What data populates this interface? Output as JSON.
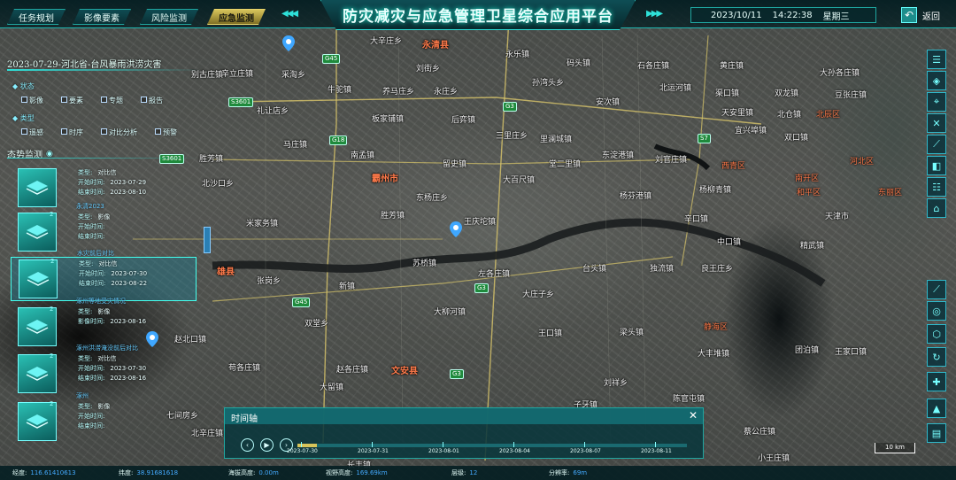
{
  "header": {
    "tabs": [
      {
        "label": "任务规划",
        "active": false
      },
      {
        "label": "影像要素",
        "active": false
      },
      {
        "label": "风险监测",
        "active": false
      },
      {
        "label": "应急监测",
        "active": true
      }
    ],
    "title": "防灾减灾与应急管理卫星综合应用平台",
    "date": "2023/10/11",
    "time": "14:22:38",
    "weekday": "星期三",
    "back_label": "返回",
    "accent_color": "#2ee0d8",
    "active_tab_color": "#d7c45a"
  },
  "left_panel": {
    "event_title": "2023-07-29-河北省-台风暴雨洪涝灾害",
    "filters": {
      "status_group": "状态",
      "status_options": [
        "影像",
        "要素",
        "专题",
        "报告"
      ],
      "type_group": "类型",
      "type_options": [
        "遥感",
        "时序",
        "对比分析",
        "预警"
      ]
    },
    "section_title": "态势监测",
    "cards": [
      {
        "name": "",
        "badge": "",
        "rows": [
          {
            "k": "类型:",
            "v": "对比信"
          },
          {
            "k": "开始时间:",
            "v": "2023-07-29"
          },
          {
            "k": "结束时间:",
            "v": "2023-08-10"
          }
        ],
        "selected": false
      },
      {
        "name": "永清2023",
        "badge": "2",
        "rows": [
          {
            "k": "类型:",
            "v": "影像"
          },
          {
            "k": "开始时间:",
            "v": ""
          },
          {
            "k": "结束时间:",
            "v": ""
          }
        ],
        "selected": false
      },
      {
        "name": "水灾前后对比",
        "badge": "2",
        "rows": [
          {
            "k": "类型:",
            "v": "对比信"
          },
          {
            "k": "开始时间:",
            "v": "2023-07-30"
          },
          {
            "k": "结束时间:",
            "v": "2023-08-22"
          }
        ],
        "selected": true
      },
      {
        "name": "涿州等地受灾情况",
        "badge": "2",
        "rows": [
          {
            "k": "类型:",
            "v": "影像"
          },
          {
            "k": "影像时间:",
            "v": "2023-08-16"
          }
        ],
        "selected": false
      },
      {
        "name": "涿州洪涝淹没前后对比",
        "badge": "2",
        "rows": [
          {
            "k": "类型:",
            "v": "对比信"
          },
          {
            "k": "开始时间:",
            "v": "2023-07-30"
          },
          {
            "k": "结束时间:",
            "v": "2023-08-16"
          }
        ],
        "selected": false
      },
      {
        "name": "涿州",
        "badge": "2",
        "rows": [
          {
            "k": "类型:",
            "v": "影像"
          },
          {
            "k": "开始时间:",
            "v": ""
          },
          {
            "k": "结束时间:",
            "v": ""
          }
        ],
        "selected": false
      }
    ]
  },
  "map": {
    "places": [
      {
        "t": "大辛庄乡"
      },
      {
        "t": "永清县",
        "c": "city"
      },
      {
        "t": "刘街乡"
      },
      {
        "t": "码头镇"
      },
      {
        "t": "石各庄镇"
      },
      {
        "t": "黄庄镇"
      },
      {
        "t": "大孙各庄镇"
      },
      {
        "t": "采淘乡"
      },
      {
        "t": "别古庄镇"
      },
      {
        "t": "永乐镇"
      },
      {
        "t": "辛立庄镇"
      },
      {
        "t": "牛驼镇"
      },
      {
        "t": "养马庄乡"
      },
      {
        "t": "永庄乡"
      },
      {
        "t": "孙湾头乡"
      },
      {
        "t": "渠口镇"
      },
      {
        "t": "双龙镇"
      },
      {
        "t": "北运河镇"
      },
      {
        "t": "豆张庄镇"
      },
      {
        "t": "后弈镇"
      },
      {
        "t": "礼让店乡"
      },
      {
        "t": "板家铺镇"
      },
      {
        "t": "安次镇"
      },
      {
        "t": "天安里镇"
      },
      {
        "t": "北辰区",
        "c": "district"
      },
      {
        "t": "马庄镇"
      },
      {
        "t": "三里庄乡"
      },
      {
        "t": "里澜城镇"
      },
      {
        "t": "宜兴埠镇"
      },
      {
        "t": "北仓镇"
      },
      {
        "t": "胜芳镇"
      },
      {
        "t": "南孟镇"
      },
      {
        "t": "刘官庄镇"
      },
      {
        "t": "双口镇"
      },
      {
        "t": "河北区",
        "c": "district"
      },
      {
        "t": "留史镇"
      },
      {
        "t": "北沙口乡"
      },
      {
        "t": "霸州市",
        "c": "city"
      },
      {
        "t": "东淀港镇"
      },
      {
        "t": "王庆坨镇"
      },
      {
        "t": "西青区",
        "c": "district"
      },
      {
        "t": "南开区",
        "c": "district"
      },
      {
        "t": "和平区",
        "c": "district"
      },
      {
        "t": "天津市"
      },
      {
        "t": "东丽区",
        "c": "district"
      },
      {
        "t": "大百尺镇"
      },
      {
        "t": "米家务镇"
      },
      {
        "t": "东杨庄乡"
      },
      {
        "t": "杨芬港镇"
      },
      {
        "t": "杨柳青镇"
      },
      {
        "t": "辛口镇"
      },
      {
        "t": "中口镇"
      },
      {
        "t": "堂二里镇"
      },
      {
        "t": "胜芳镇"
      },
      {
        "t": "精武镇"
      },
      {
        "t": "雄县",
        "c": "city"
      },
      {
        "t": "张岗乡"
      },
      {
        "t": "苏桥镇"
      },
      {
        "t": "台头镇"
      },
      {
        "t": "独流镇"
      },
      {
        "t": "良王庄乡"
      },
      {
        "t": "新镇"
      },
      {
        "t": "文安县",
        "c": "city"
      },
      {
        "t": "静海区",
        "c": "district"
      },
      {
        "t": "大庄子乡"
      },
      {
        "t": "大柳河镇"
      },
      {
        "t": "梁头镇"
      },
      {
        "t": "大丰堆镇"
      },
      {
        "t": "团泊镇"
      },
      {
        "t": "左各庄镇"
      },
      {
        "t": "苟各庄镇"
      },
      {
        "t": "赵北口镇"
      },
      {
        "t": "大留镇"
      },
      {
        "t": "陈官屯镇"
      },
      {
        "t": "蔡公庄镇"
      },
      {
        "t": "双堂乡"
      },
      {
        "t": "王口镇"
      },
      {
        "t": "小王庄镇"
      },
      {
        "t": "长丰镇"
      },
      {
        "t": "七间房乡"
      },
      {
        "t": "王家口镇"
      },
      {
        "t": "赵各庄镇"
      },
      {
        "t": "子牙镇"
      },
      {
        "t": "刘祥乡"
      },
      {
        "t": "北辛庄镇"
      }
    ],
    "roads": [
      "G45",
      "G3",
      "G18",
      "S7",
      "G45",
      "G3",
      "G3",
      "S3601",
      "S3601"
    ]
  },
  "right_toolbar": {
    "top_icons": [
      "list-icon",
      "layers-icon",
      "pin-icon",
      "close-measure-icon",
      "ruler-icon",
      "split-icon",
      "chart-icon",
      "bank-icon"
    ],
    "bottom_icons": [
      "measure-icon",
      "layers-3d-icon",
      "cube-icon",
      "rotate-icon",
      "pin-map-icon",
      "user-icon",
      "data-icon"
    ]
  },
  "timeline": {
    "title": "时间轴",
    "ticks": [
      "2023-07-30",
      "2023-07-31",
      "2023-08-01",
      "2023-08-04",
      "2023-08-07",
      "2023-08-11"
    ],
    "progress_fraction": 0.05
  },
  "scale_label": "10 km",
  "statusbar": {
    "lon_label": "经度:",
    "lon": "116.61410613",
    "lat_label": "纬度:",
    "lat": "38.91681618",
    "alt_label": "海拔高度:",
    "alt": "0.00m",
    "view_label": "视野高度:",
    "view": "169.69km",
    "level_label": "层级:",
    "level": "12",
    "res_label": "分辨率:",
    "res": "69m"
  }
}
